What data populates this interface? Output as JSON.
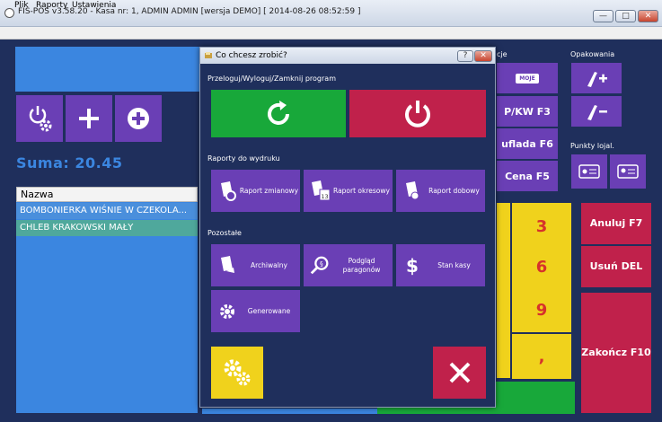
{
  "window": {
    "title": "FIS-POS v3.58.20 - Kasa nr: 1, ADMIN ADMIN [wersja DEMO]  [ 2014-08-26 08:52:59 ]",
    "minimize": "—",
    "maximize": "□",
    "close": "✕"
  },
  "menu": {
    "items": [
      "Plik",
      "Raporty",
      "Ustawienia"
    ]
  },
  "main": {
    "sum_label": "Suma: 20.45",
    "list_header": "Nazwa",
    "rows": [
      "BOMBONIERKA WIŚNIE W CZEKOLA...",
      "CHLEB KRAKOWSKI MAŁY"
    ]
  },
  "right": {
    "opakowania_title": "Opakowania",
    "opakowania_partial_title": "cje",
    "punkty_title": "Punkty lojal.",
    "moje_label": "MOJE",
    "btn_pkw": "P/KW F3",
    "btn_szuflada": "uflada F6",
    "btn_cena": "Cena F5",
    "numbers": [
      "3",
      "6",
      "9",
      ","
    ],
    "anuluj": "Anuluj F7",
    "usun": "Usuń DEL",
    "zakoncz": "Zakończ F10"
  },
  "dialog": {
    "title": "Co chcesz zrobić?",
    "close": "✕",
    "help": "?",
    "section1": "Przeloguj/Wyloguj/Zamknij program",
    "section2": "Raporty do wydruku",
    "section3": "Pozostałe",
    "report_zmianowy": "Raport zmianowy",
    "report_okresowy": "Raport okresowy",
    "report_dobowy": "Raport dobowy",
    "archiwalny": "Archiwalny",
    "podglad": "Podgląd paragonów",
    "stan_kasy": "Stan kasy",
    "generowane": "Generowane",
    "calendar_day": "13"
  },
  "colors": {
    "background": "#1f2f5c",
    "purple": "#6a3fb5",
    "green": "#18a83a",
    "red": "#c0214b",
    "yellow": "#f0d21c",
    "blue": "#3b86e0"
  }
}
